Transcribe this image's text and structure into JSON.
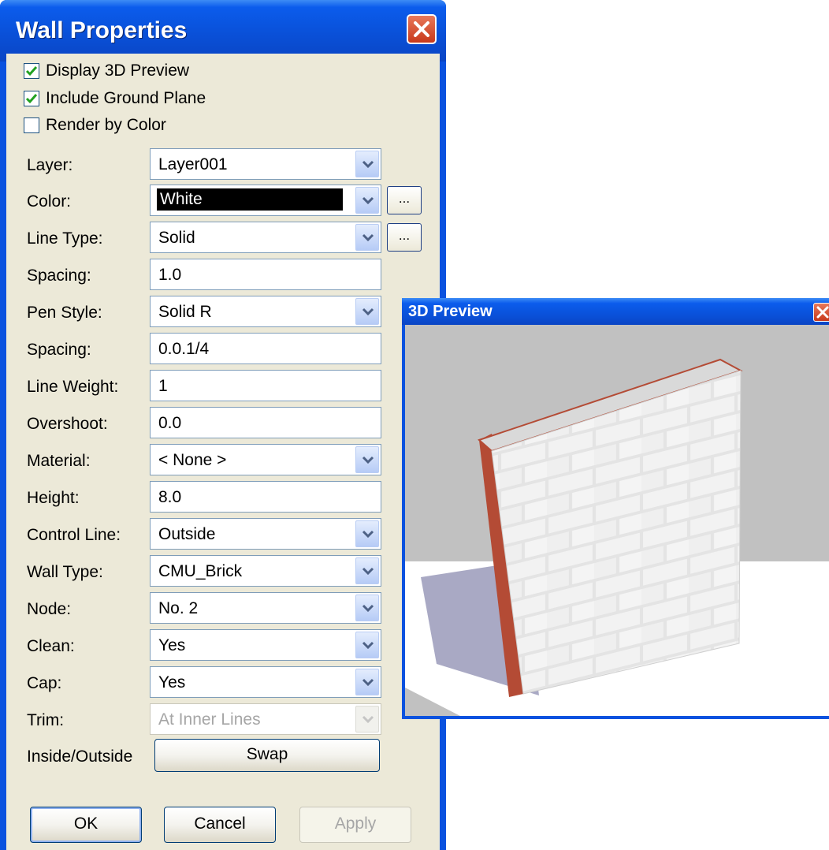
{
  "dialog": {
    "title": "Wall Properties",
    "checkboxes": [
      {
        "label": "Display 3D Preview",
        "checked": true
      },
      {
        "label": "Include Ground Plane",
        "checked": true
      },
      {
        "label": "Render by Color",
        "checked": false
      }
    ],
    "fields": {
      "layer": {
        "label": "Layer:",
        "value": "Layer001"
      },
      "color": {
        "label": "Color:",
        "value": "White"
      },
      "line_type": {
        "label": "Line Type:",
        "value": "Solid"
      },
      "spacing1": {
        "label": "Spacing:",
        "value": "1.0"
      },
      "pen_style": {
        "label": "Pen Style:",
        "value": "Solid R"
      },
      "spacing2": {
        "label": "Spacing:",
        "value": "0.0.1/4"
      },
      "line_weight": {
        "label": "Line Weight:",
        "value": "1"
      },
      "overshoot": {
        "label": "Overshoot:",
        "value": "0.0"
      },
      "material": {
        "label": "Material:",
        "value": "< None >"
      },
      "height": {
        "label": "Height:",
        "value": "8.0"
      },
      "control_line": {
        "label": "Control Line:",
        "value": "Outside"
      },
      "wall_type": {
        "label": "Wall Type:",
        "value": "CMU_Brick"
      },
      "node": {
        "label": "Node:",
        "value": "No. 2"
      },
      "clean": {
        "label": "Clean:",
        "value": "Yes"
      },
      "cap": {
        "label": "Cap:",
        "value": "Yes"
      },
      "trim": {
        "label": "Trim:",
        "value": "At Inner Lines"
      },
      "inside_outside": {
        "label": "Inside/Outside",
        "button": "Swap"
      }
    },
    "ellipsis_label": "...",
    "buttons": {
      "ok": "OK",
      "cancel": "Cancel",
      "apply": "Apply"
    }
  },
  "preview": {
    "title": "3D Preview"
  },
  "colors": {
    "titlebar": "#0a52df",
    "dialog_bg": "#ece9d8",
    "close_button": "#d4502f",
    "check_mark": "#21a121",
    "scene_bg": "#c1c1c1",
    "ground": "#ffffff",
    "shadow": "#a9a9c4",
    "brick": "#e6e6e6",
    "brick_edge": "#b44b35"
  },
  "icons": [
    "close-icon",
    "check-icon",
    "chevron-down-icon"
  ]
}
